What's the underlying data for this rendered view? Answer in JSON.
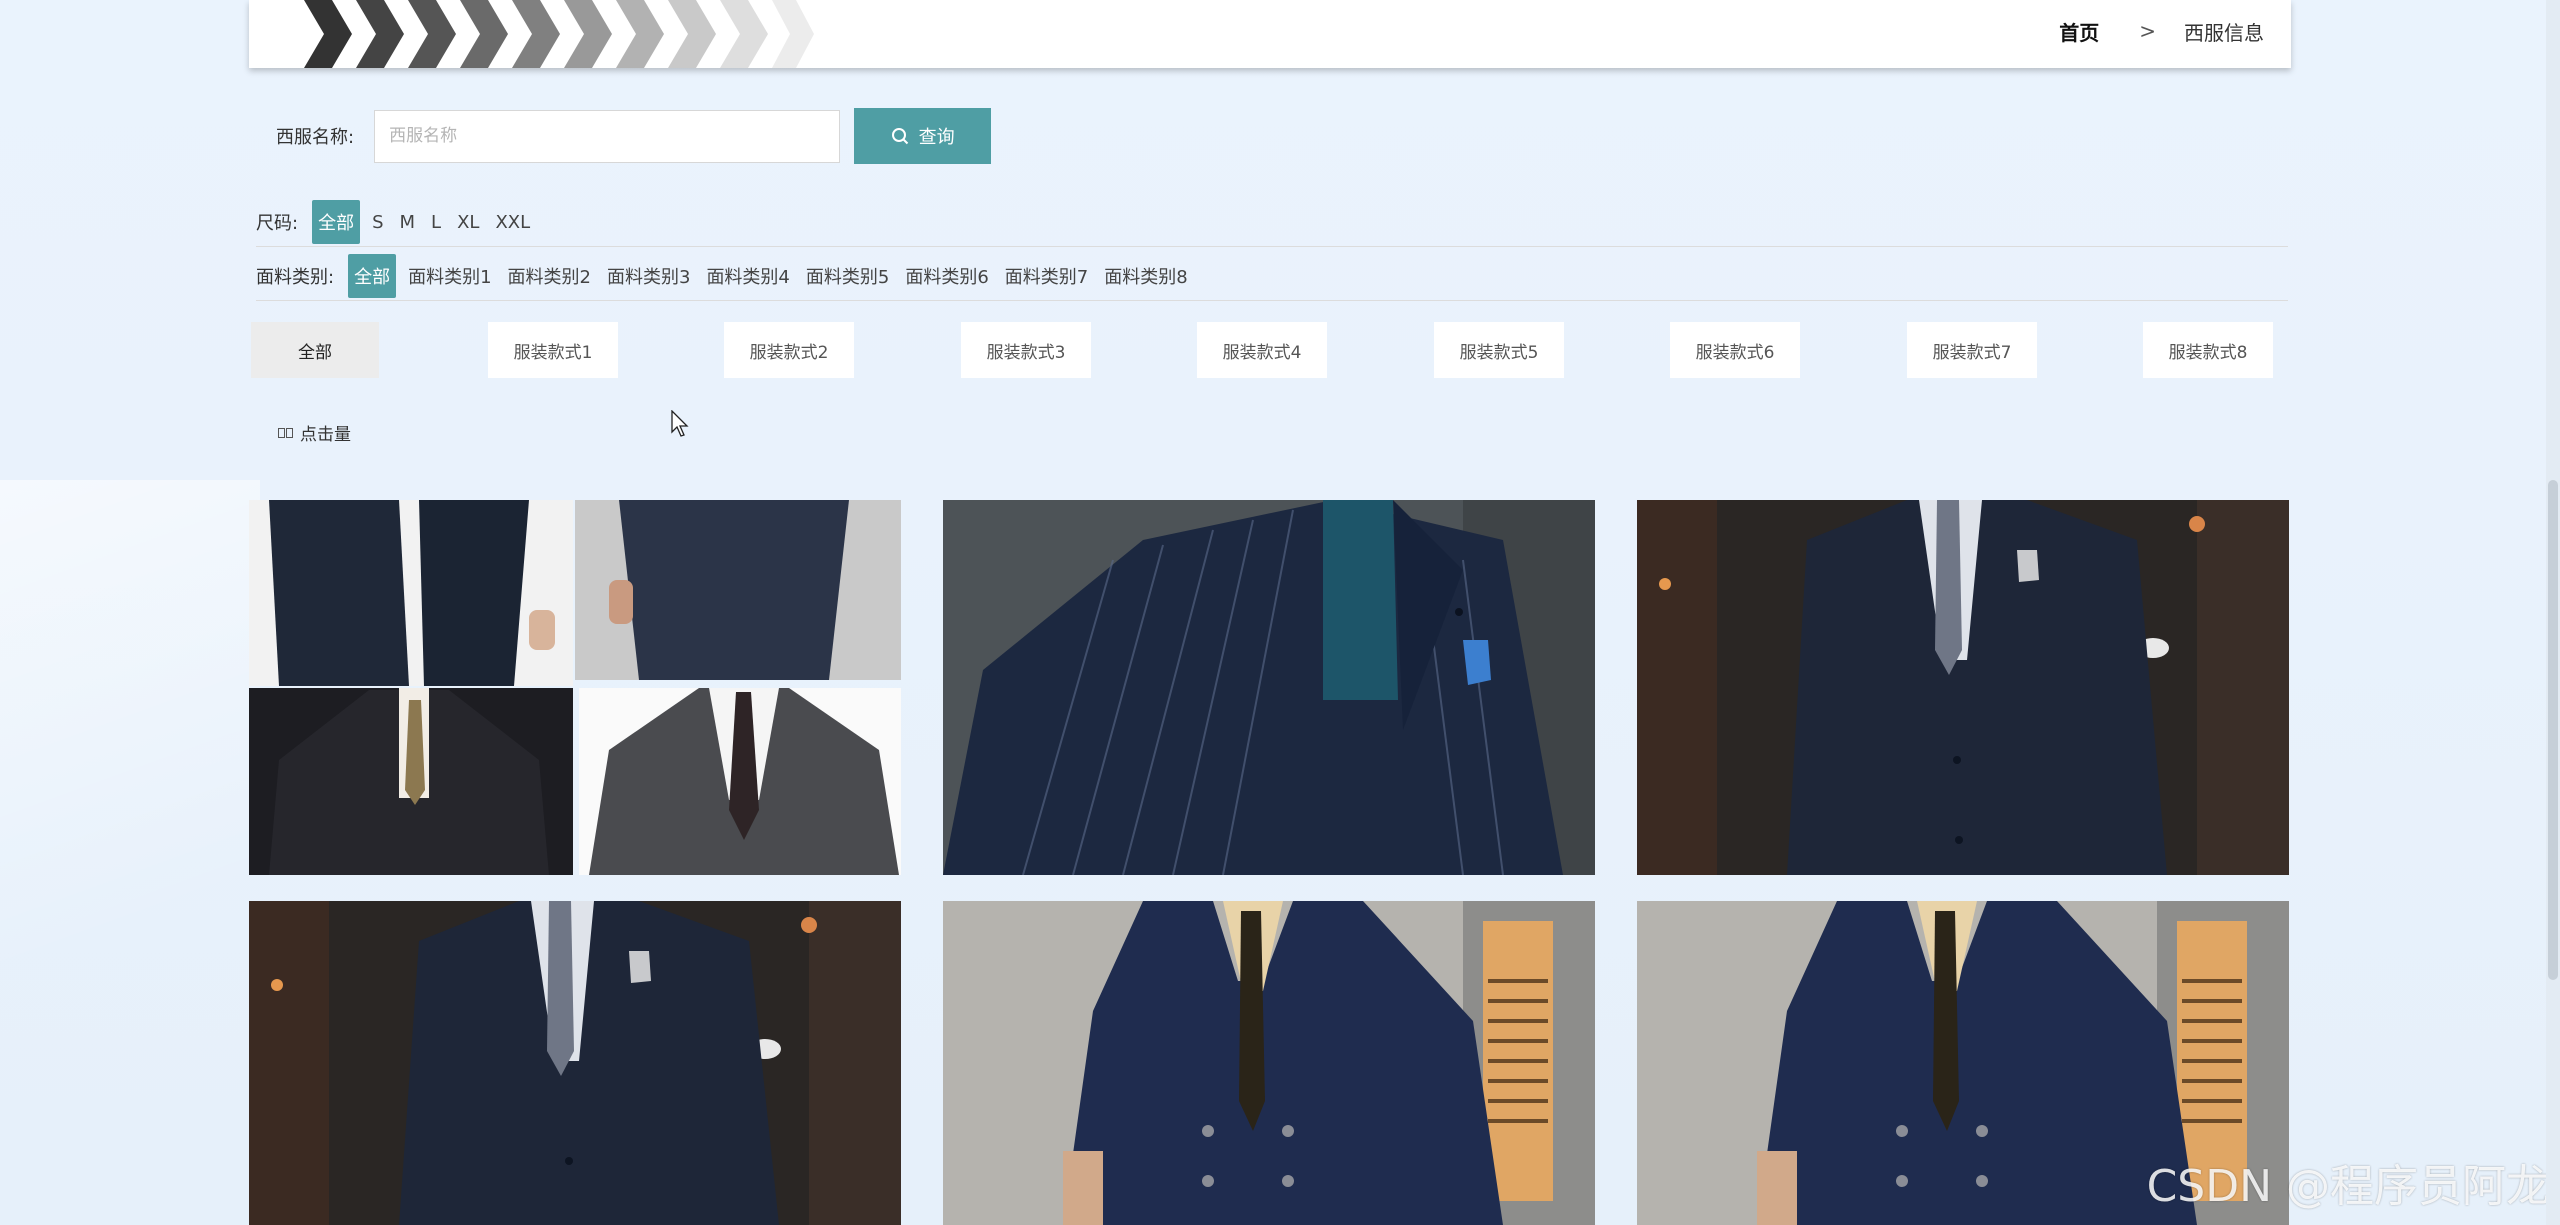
{
  "header": {
    "breadcrumb": {
      "home": "首页",
      "sep": ">",
      "current": "西服信息"
    }
  },
  "search": {
    "label": "西服名称:",
    "placeholder": "西服名称",
    "button_label": "查询"
  },
  "filters": {
    "size": {
      "label": "尺码:",
      "options": [
        "全部",
        "S",
        "M",
        "L",
        "XL",
        "XXL"
      ],
      "selected": 0
    },
    "fabric": {
      "label": "面料类别:",
      "options": [
        "全部",
        "面料类别1",
        "面料类别2",
        "面料类别3",
        "面料类别4",
        "面料类别5",
        "面料类别6",
        "面料类别7",
        "面料类别8"
      ],
      "selected": 0
    },
    "style": {
      "options": [
        "全部",
        "服装款式1",
        "服装款式2",
        "服装款式3",
        "服装款式4",
        "服装款式5",
        "服装款式6",
        "服装款式7",
        "服装款式8"
      ],
      "selected": 0
    }
  },
  "sort": {
    "label": "点击量"
  },
  "watermark": "CSDN @程序员阿龙",
  "colors": {
    "accent": "#4f9ea4",
    "suit_navy": "#1e2b45",
    "suit_gray": "#4a4b4f"
  }
}
